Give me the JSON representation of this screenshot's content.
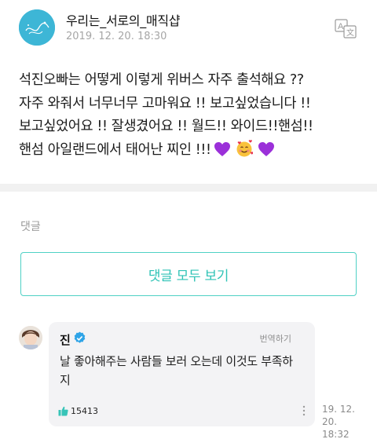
{
  "post": {
    "author": "우리는_서로의_매직샵",
    "date": "2019. 12. 20. 18:30",
    "lines": [
      "석진오빠는 어떻게 이렇게 위버스 자주 출석해요 ??",
      "자주 와줘서 너무너무 고마워요 !! 보고싶었습니다 !!",
      "보고싶었어요 !! 잘생겼어요 !! 월드!! 와이드!!핸섬!!",
      "핸섬 아일랜드에서 태어난 찌인 !!!"
    ],
    "emojis": [
      "purple-heart",
      "smiling-face-with-hearts",
      "purple-heart"
    ]
  },
  "comments_section": {
    "label": "댓글",
    "view_all_label": "댓글 모두 보기"
  },
  "comment": {
    "name": "진",
    "translate_label": "번역하기",
    "text": "날 좋아해주는 사람들 보러 오는데 이것도 부족하지",
    "likes": "15413",
    "date_line1": "19. 12. 20.",
    "date_line2": "18:32"
  },
  "colors": {
    "accent": "#4fd1c5",
    "verified": "#2fa4e7",
    "heart": "#9b30d9"
  }
}
